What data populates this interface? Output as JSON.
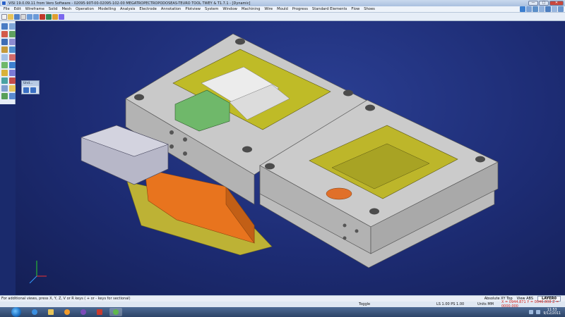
{
  "window": {
    "title": "VISI 19.0.09.11 from Vero Software - 02095-90T-00-02095-102-00 MEGATROPECTROPODOSEAS-TEURO TOOL TWEY & T1.7.1 - [Dynamic]",
    "buttons": [
      "—",
      "□",
      "✕"
    ]
  },
  "menu": {
    "items": [
      "File",
      "Edit",
      "Wireframe",
      "Solid",
      "Mesh",
      "Operation",
      "Modelling",
      "Analysis",
      "Electrode",
      "Annotation",
      "Plotview",
      "System",
      "Window",
      "Machining",
      "Wire",
      "Mould",
      "Progress",
      "Standard Elements",
      "Flow",
      "Shoes"
    ]
  },
  "undo_panel": {
    "title": "Und..."
  },
  "status": {
    "hint": "For additional views, press X, Y, Z, V or R keys ( + or - keys for sectional)",
    "view_mode": "Absolute XY Top",
    "view_name": "View ABS",
    "layer": "LAYER0",
    "toggle": "Toggle",
    "ls_ps": "LS 1.00 PS 1.00",
    "units": "Units MM",
    "coords": "X = 0944.871 Y = 0046.808 Z = 0000.000"
  },
  "taskbar": {
    "time": "11:53",
    "date": "9/12/2011"
  },
  "colors": {
    "steel": "#c7c7c7",
    "cavity": "#b8b21c",
    "orange": "#e8741e",
    "green": "#6fb86a",
    "viewport": "#1d2c74"
  }
}
